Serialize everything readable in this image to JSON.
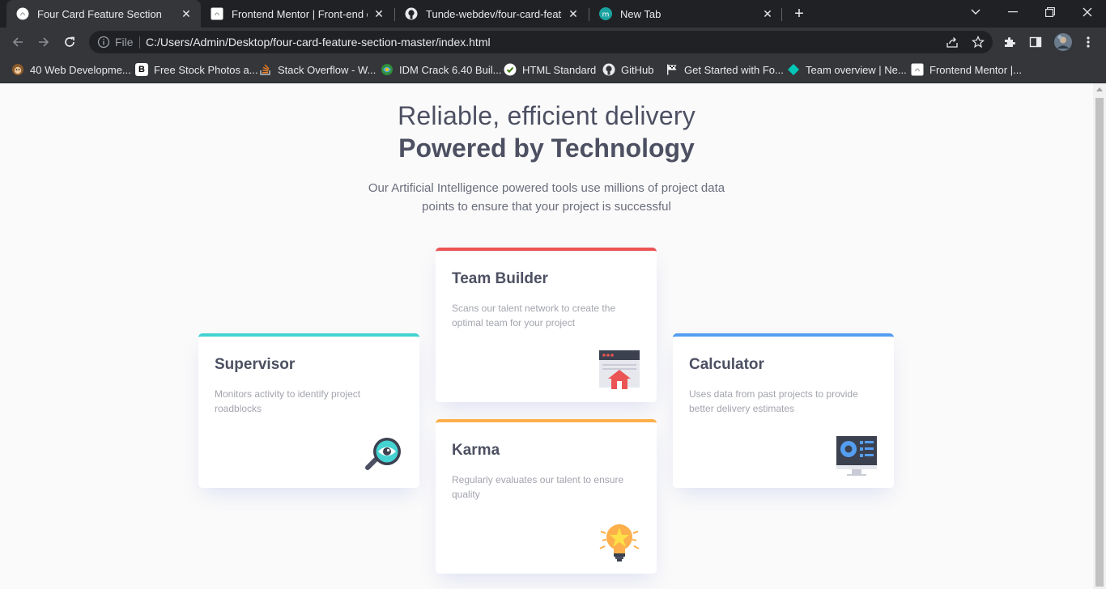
{
  "browser": {
    "tabs": [
      {
        "title": "Four Card Feature Section",
        "active": true
      },
      {
        "title": "Frontend Mentor | Front-end coding challenges",
        "active": false
      },
      {
        "title": "Tunde-webdev/four-card-feature",
        "active": false
      },
      {
        "title": "New Tab",
        "active": false
      }
    ],
    "address": {
      "scheme_label": "File",
      "url": "C:/Users/Admin/Desktop/four-card-feature-section-master/index.html"
    },
    "bookmarks": [
      {
        "label": "40 Web Developme...",
        "icon": "monkey-icon"
      },
      {
        "label": "Free Stock Photos a...",
        "icon": "b-letter-icon"
      },
      {
        "label": "Stack Overflow - W...",
        "icon": "stackoverflow-icon"
      },
      {
        "label": "IDM Crack 6.40 Buil...",
        "icon": "idm-icon"
      },
      {
        "label": "HTML Standard",
        "icon": "whatwg-icon"
      },
      {
        "label": "GitHub",
        "icon": "github-icon"
      },
      {
        "label": "Get Started with Fo...",
        "icon": "flag-icon"
      },
      {
        "label": "Team overview | Ne...",
        "icon": "diamond-icon"
      },
      {
        "label": "Frontend Mentor |...",
        "icon": "frontendmentor-icon"
      }
    ]
  },
  "page": {
    "headline_light": "Reliable, efficient delivery",
    "headline_bold": "Powered by Technology",
    "intro": "Our Artificial Intelligence powered tools use millions of project data points to ensure that your project is successful",
    "cards": {
      "supervisor": {
        "title": "Supervisor",
        "text": "Monitors activity to identify project roadblocks",
        "accent": "#44d3d2",
        "icon": "magnifier-eye-icon"
      },
      "team_builder": {
        "title": "Team Builder",
        "text": "Scans our talent network to create the optimal team for your project",
        "accent": "#ea5454",
        "icon": "team-builder-icon"
      },
      "karma": {
        "title": "Karma",
        "text": "Regularly evaluates our talent to ensure quality",
        "accent": "#fcaf4a",
        "icon": "lightbulb-icon"
      },
      "calculator": {
        "title": "Calculator",
        "text": "Uses data from past projects to provide better delivery estimates",
        "accent": "#549ef2",
        "icon": "calculator-monitor-icon"
      }
    }
  }
}
